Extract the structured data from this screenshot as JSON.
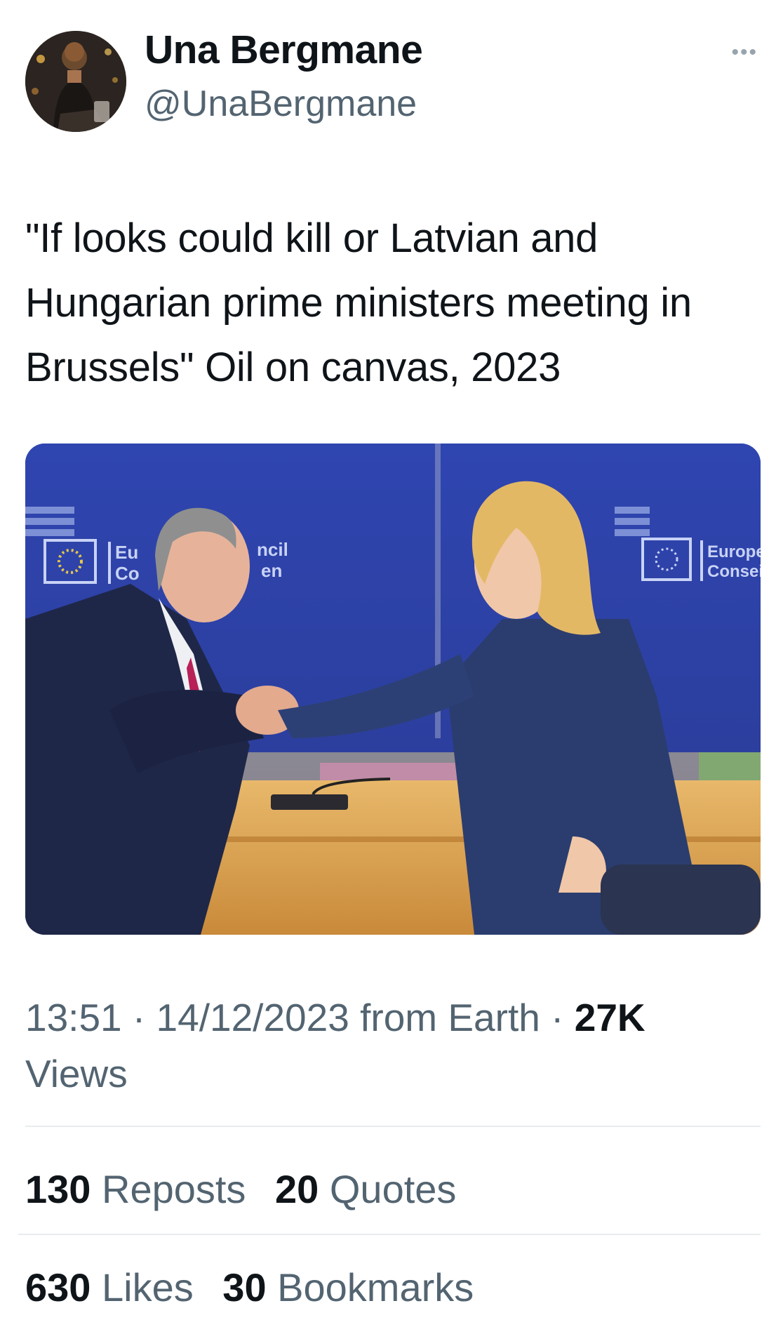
{
  "author": {
    "display_name": "Una Bergmane",
    "handle": "@UnaBergmane",
    "more_icon": "more-horizontal-icon"
  },
  "tweet": {
    "text": "\"If looks could kill or Latvian and Hungarian prime ministers meeting in Brussels\" Oil on canvas, 2023"
  },
  "media": {
    "kind": "photo",
    "left_sign": {
      "line1": "Eu",
      "line2": "Co",
      "line3": "ncil",
      "line4": "en"
    },
    "right_sign": {
      "line1": "Europea",
      "line2": "Conseil"
    }
  },
  "meta": {
    "time": "13:51",
    "date": "14/12/2023",
    "source": "from Earth",
    "views_count": "27K",
    "views_label": "Views",
    "separator": "·"
  },
  "stats": {
    "reposts_count": "130",
    "reposts_label": "Reposts",
    "quotes_count": "20",
    "quotes_label": "Quotes",
    "likes_count": "630",
    "likes_label": "Likes",
    "bookmarks_count": "30",
    "bookmarks_label": "Bookmarks"
  },
  "colors": {
    "text_primary": "#0f1419",
    "text_secondary": "#536471",
    "divider": "#e6ecf0",
    "photo_backdrop": "#2c3f9a"
  }
}
